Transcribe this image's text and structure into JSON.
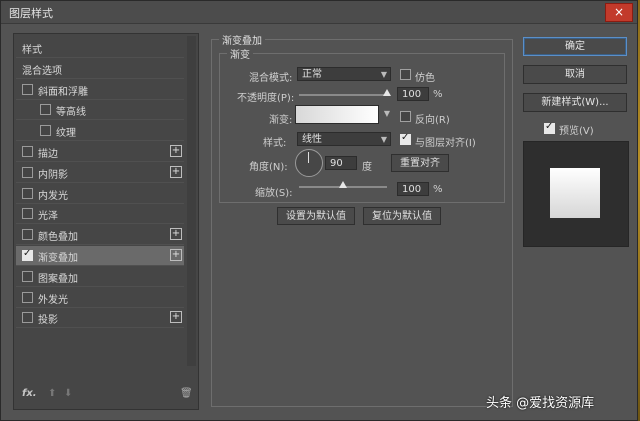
{
  "window": {
    "title": "图层样式",
    "close_icon": "×"
  },
  "sidebar": {
    "items": [
      {
        "label": "样式",
        "type": "plain"
      },
      {
        "label": "混合选项",
        "type": "plain"
      },
      {
        "label": "斜面和浮雕",
        "checked": false,
        "plus": false
      },
      {
        "label": "等高线",
        "checked": false,
        "indent": true
      },
      {
        "label": "纹理",
        "checked": false,
        "indent": true
      },
      {
        "label": "描边",
        "checked": false,
        "plus": true
      },
      {
        "label": "内阴影",
        "checked": false,
        "plus": true
      },
      {
        "label": "内发光",
        "checked": false
      },
      {
        "label": "光泽",
        "checked": false
      },
      {
        "label": "颜色叠加",
        "checked": false,
        "plus": true
      },
      {
        "label": "渐变叠加",
        "checked": true,
        "plus": true,
        "active": true
      },
      {
        "label": "图案叠加",
        "checked": false
      },
      {
        "label": "外发光",
        "checked": false
      },
      {
        "label": "投影",
        "checked": false,
        "plus": true
      }
    ],
    "footer": {
      "fx": "fx.",
      "up": "⬆",
      "down": "⬇",
      "trash": "🗑"
    }
  },
  "panel": {
    "group_title": "渐变叠加",
    "sub_title": "渐变",
    "blend_mode_label": "混合模式:",
    "blend_mode_value": "正常",
    "dither_label": "仿色",
    "opacity_label": "不透明度(P):",
    "opacity_value": "100",
    "opacity_unit": "%",
    "opacity_level": 1.0,
    "gradient_label": "渐变:",
    "reverse_label": "反向(R)",
    "style_label": "样式:",
    "style_value": "线性",
    "align_label": "与图层对齐(I)",
    "align_checked": true,
    "angle_label": "角度(N):",
    "angle_value": "90",
    "angle_unit": "度",
    "reset_align_button": "重置对齐",
    "scale_label": "缩放(S):",
    "scale_value": "100",
    "scale_unit": "%",
    "scale_level": 0.5,
    "set_default_button": "设置为默认值",
    "reset_default_button": "复位为默认值"
  },
  "right": {
    "ok_button": "确定",
    "cancel_button": "取消",
    "new_style_button": "新建样式(W)...",
    "preview_label": "预览(V)",
    "preview_checked": true
  },
  "watermark": "头条 @爱找资源库"
}
